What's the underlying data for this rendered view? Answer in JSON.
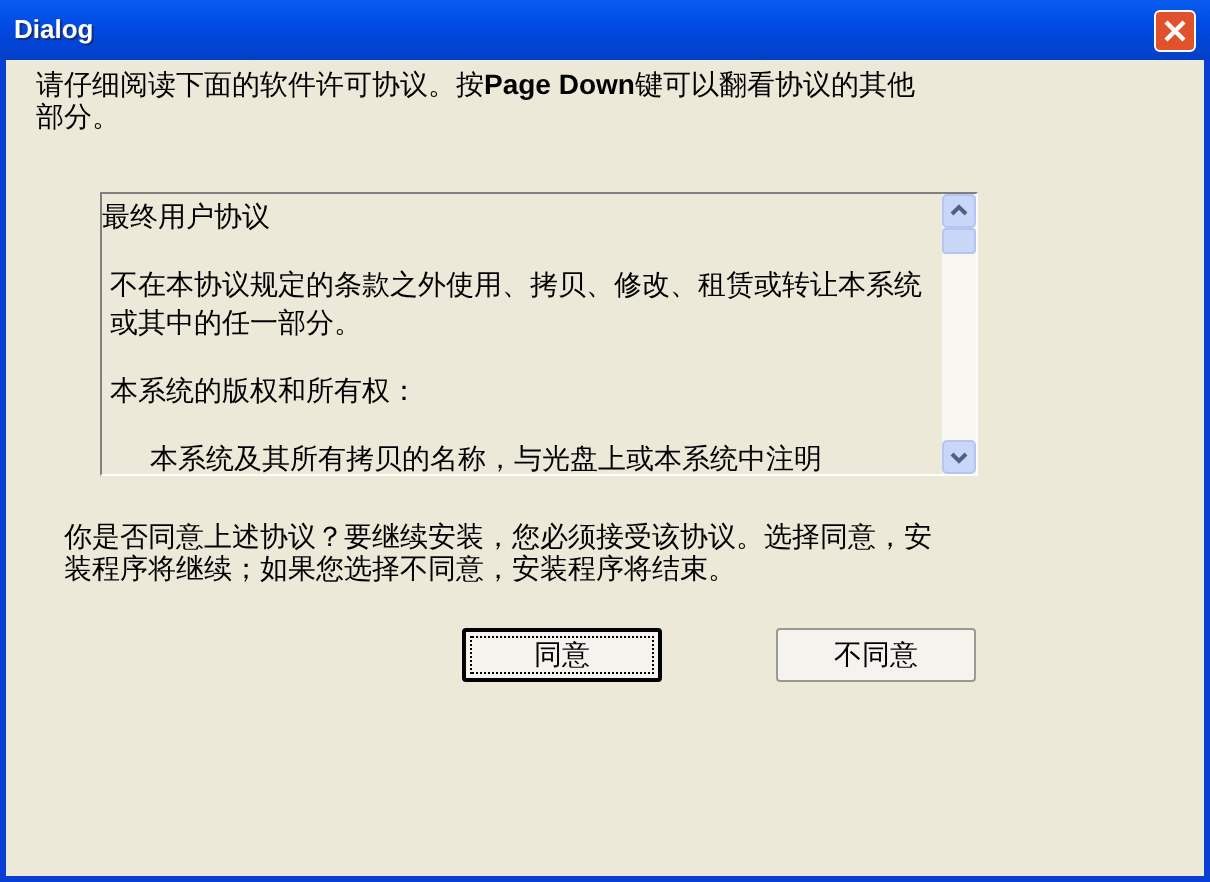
{
  "window": {
    "title": "Dialog"
  },
  "intro": "请仔细阅读下面的软件许可协议。按**Page Down**键可以翻看协议的其他部分。",
  "agreement": {
    "paragraphs": [
      {
        "kind": "title",
        "text": "最终用户协议"
      },
      {
        "kind": "text",
        "text": "不在本协议规定的条款之外使用、拷贝、修改、租赁或转让本系统或其中的任一部分。"
      },
      {
        "kind": "text",
        "text": "本系统的版权和所有权："
      },
      {
        "kind": "indented",
        "text": "本系统及其所有拷贝的名称，与光盘上或本系统中注明"
      }
    ]
  },
  "question": "你是否同意上述协议？要继续安装，您必须接受该协议。选择同意，安装程序将继续；如果您选择不同意，安装程序将结束。",
  "buttons": [
    {
      "label": "同意",
      "focused": true
    },
    {
      "label": "不同意",
      "focused": false
    }
  ]
}
